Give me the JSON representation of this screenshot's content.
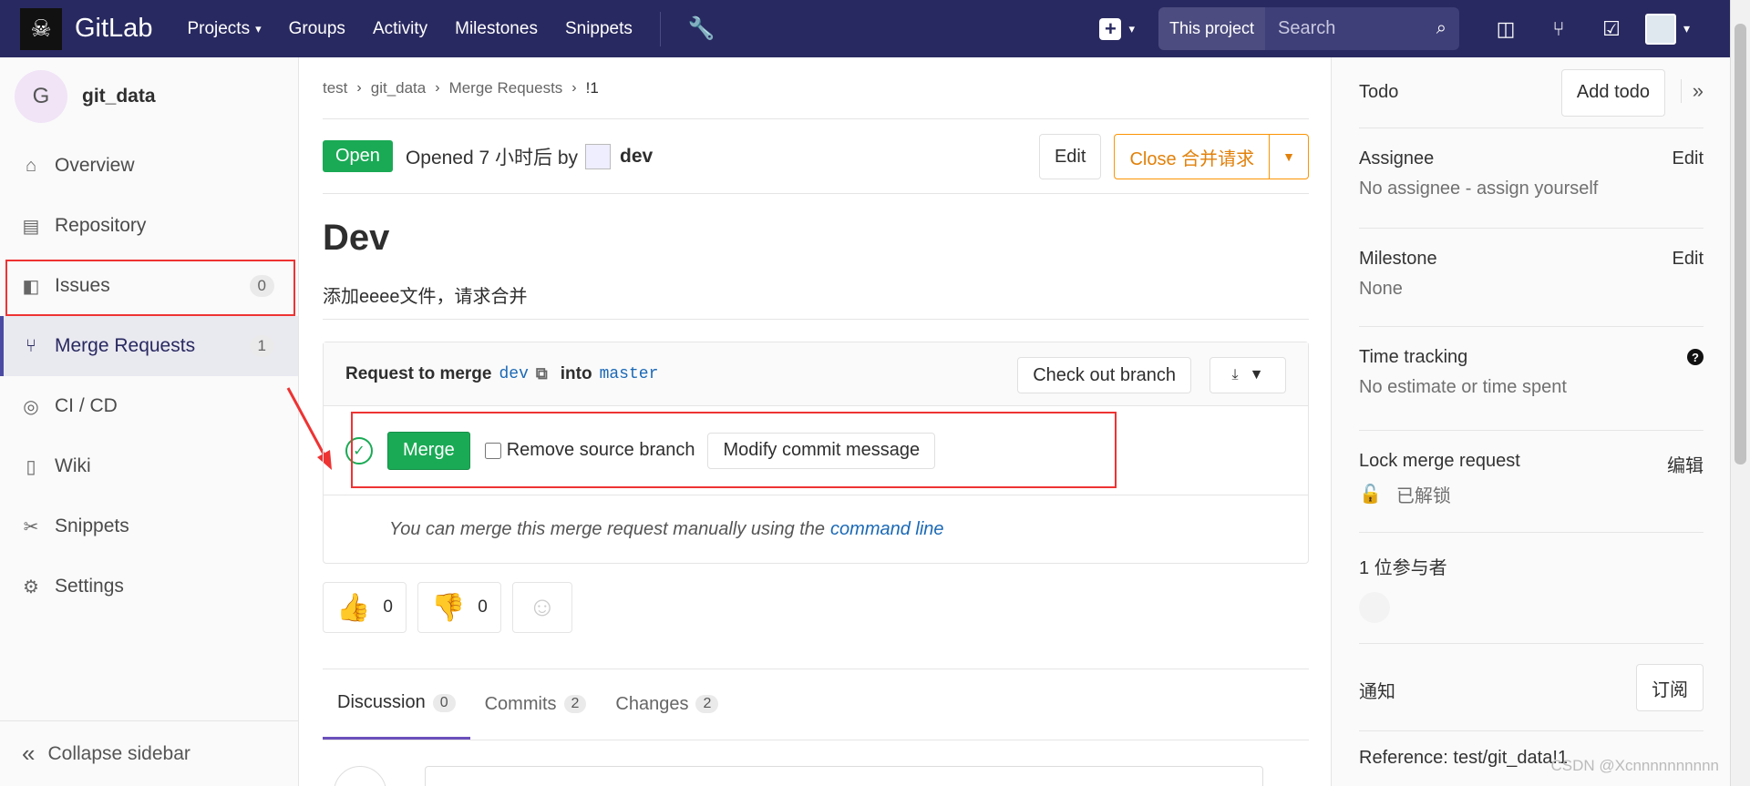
{
  "navbar": {
    "brand": "GitLab",
    "links": [
      {
        "label": "Projects",
        "has_caret": true
      },
      {
        "label": "Groups",
        "has_caret": false
      },
      {
        "label": "Activity",
        "has_caret": false
      },
      {
        "label": "Milestones",
        "has_caret": false
      },
      {
        "label": "Snippets",
        "has_caret": false
      }
    ],
    "search_scope": "This project",
    "search_placeholder": "Search",
    "bg_color": "#292961"
  },
  "sidebar": {
    "project_initial": "G",
    "project_name": "git_data",
    "items": [
      {
        "label": "Overview",
        "icon": "home-icon",
        "badge": null
      },
      {
        "label": "Repository",
        "icon": "file-icon",
        "badge": null
      },
      {
        "label": "Issues",
        "icon": "issues-icon",
        "badge": "0"
      },
      {
        "label": "Merge Requests",
        "icon": "merge-request-icon",
        "badge": "1"
      },
      {
        "label": "CI / CD",
        "icon": "rocket-icon",
        "badge": null
      },
      {
        "label": "Wiki",
        "icon": "book-icon",
        "badge": null
      },
      {
        "label": "Snippets",
        "icon": "scissors-icon",
        "badge": null
      },
      {
        "label": "Settings",
        "icon": "gear-icon",
        "badge": null
      }
    ],
    "collapse_label": "Collapse sidebar"
  },
  "breadcrumb": [
    "test",
    "git_data",
    "Merge Requests",
    "!1"
  ],
  "mr": {
    "status": "Open",
    "opened_text": "Opened 7 小时后 by",
    "author": "dev",
    "edit_label": "Edit",
    "close_label": "Close 合并请求",
    "title": "Dev",
    "description": "添加eeee文件，请求合并"
  },
  "merge_widget": {
    "request_prefix": "Request to merge",
    "source_branch": "dev",
    "into": "into",
    "target_branch": "master",
    "checkout_label": "Check out branch",
    "merge_label": "Merge",
    "remove_source_label": "Remove source branch",
    "modify_commit_label": "Modify commit message",
    "manual_text": "You can merge this merge request manually using the",
    "command_line_link": "command line"
  },
  "awards": [
    {
      "emoji": "thumbsup-icon",
      "count": "0"
    },
    {
      "emoji": "thumbsdown-icon",
      "count": "0"
    }
  ],
  "tabs": [
    {
      "label": "Discussion",
      "count": "0"
    },
    {
      "label": "Commits",
      "count": "2"
    },
    {
      "label": "Changes",
      "count": "2"
    }
  ],
  "right_sidebar": {
    "todo_label": "Todo",
    "add_todo_label": "Add todo",
    "assignee_title": "Assignee",
    "assignee_edit": "Edit",
    "assignee_value": "No assignee - assign yourself",
    "milestone_title": "Milestone",
    "milestone_edit": "Edit",
    "milestone_value": "None",
    "time_title": "Time tracking",
    "time_value": "No estimate or time spent",
    "lock_title": "Lock merge request",
    "lock_edit": "编辑",
    "lock_value": "已解锁",
    "participants_title": "1 位参与者",
    "notify_title": "通知",
    "subscribe_label": "订阅",
    "reference": "Reference: test/git_data!1"
  },
  "watermark": "CSDN @Xcnnnnnnnnnn",
  "colors": {
    "accent": "#1aaa55",
    "close": "#fc9403",
    "link": "#1b69b6",
    "highlight": "#ee3333"
  }
}
